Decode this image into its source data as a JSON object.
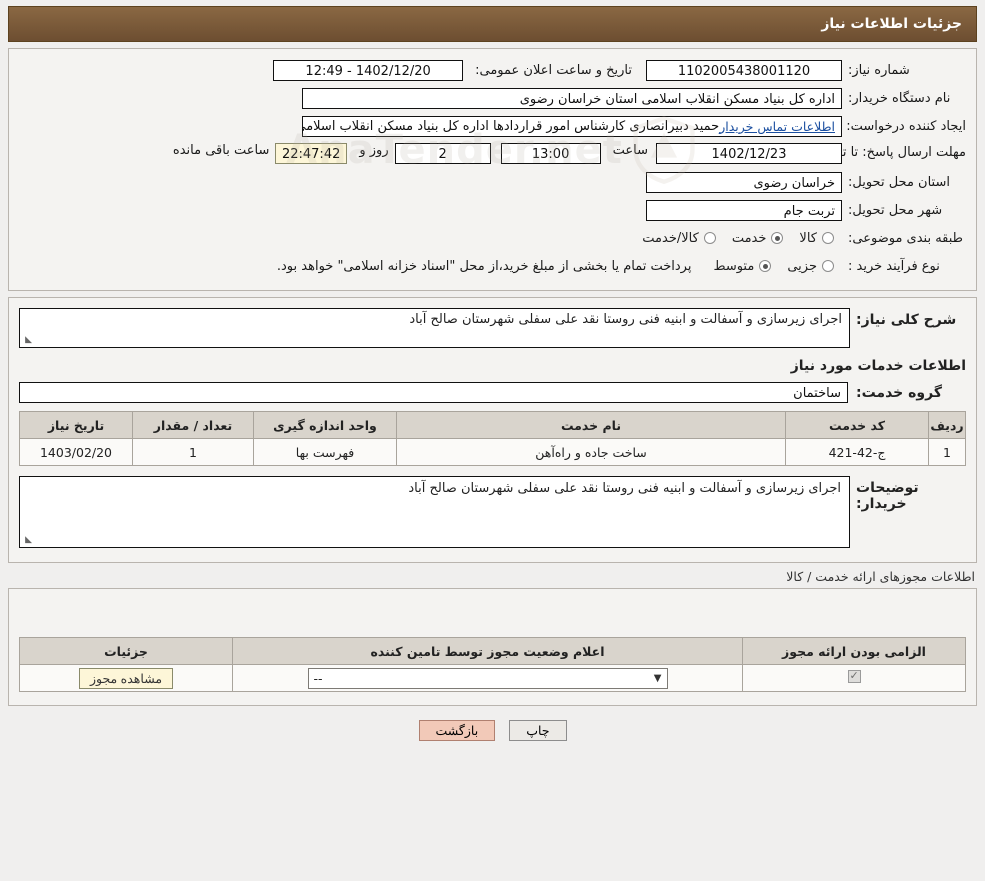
{
  "header": {
    "title": "جزئیات اطلاعات نیاز"
  },
  "need": {
    "number_label": "شماره نیاز:",
    "number_value": "1102005438001120",
    "announce_label": "تاریخ و ساعت اعلان عمومی:",
    "announce_value": "1402/12/20 - 12:49",
    "buyer_org_label": "نام دستگاه خریدار:",
    "buyer_org_value": "اداره کل بنیاد مسکن انقلاب اسلامی استان خراسان رضوی",
    "creator_label": "ایجاد کننده درخواست:",
    "creator_value": "حمید دبیرانصاری کارشناس امور قراردادها اداره کل بنیاد مسکن انقلاب اسلامی ا",
    "creator_link": "اطلاعات تماس خریدار",
    "deadline_label": "مهلت ارسال پاسخ: تا تاریخ:",
    "deadline_date": "1402/12/23",
    "hour_label": "ساعت",
    "deadline_time": "13:00",
    "days_value": "2",
    "days_label": "روز و",
    "remaining_time": "22:47:42",
    "remaining_label": "ساعت باقی مانده",
    "province_label": "استان محل تحویل:",
    "province_value": "خراسان رضوی",
    "city_label": "شهر محل تحویل:",
    "city_value": "تربت جام",
    "category_label": "طبقه بندی موضوعی:",
    "category_options": [
      {
        "label": "کالا",
        "selected": false
      },
      {
        "label": "خدمت",
        "selected": true
      },
      {
        "label": "کالا/خدمت",
        "selected": false
      }
    ],
    "process_label": "نوع فرآیند خرید :",
    "process_options": [
      {
        "label": "جزیی",
        "selected": false
      },
      {
        "label": "متوسط",
        "selected": true
      }
    ],
    "process_note": "پرداخت تمام یا بخشی از مبلغ خرید،از محل \"اسناد خزانه اسلامی\" خواهد بود."
  },
  "watermark": {
    "text": "AnaTender.net"
  },
  "summary": {
    "label": "شرح کلی نیاز:",
    "value": "اجرای زیرسازی و آسفالت و ابنیه فنی روستا نقد علی سفلی شهرستان صالح آباد"
  },
  "services": {
    "title": "اطلاعات خدمات مورد نیاز",
    "group_label": "گروه خدمت:",
    "group_value": "ساختمان",
    "table": {
      "columns": [
        "ردیف",
        "کد خدمت",
        "نام خدمت",
        "واحد اندازه گیری",
        "تعداد / مقدار",
        "تاریخ نیاز"
      ],
      "rows": [
        [
          "1",
          "ج-42-421",
          "ساخت جاده و راه‌آهن",
          "فهرست بها",
          "1",
          "1403/02/20"
        ]
      ]
    }
  },
  "buyer_notes": {
    "label": "توضیحات خریدار:",
    "value": "اجرای زیرسازی و آسفالت و ابنیه فنی روستا نقد علی سفلی شهرستان صالح آباد"
  },
  "licenses": {
    "note": "اطلاعات مجوزهای ارائه خدمت / کالا",
    "columns": [
      "الزامی بودن ارائه مجوز",
      "اعلام وضعیت مجوز توسط تامین کننده",
      "جزئیات"
    ],
    "rows": [
      {
        "required_checked": true,
        "status_value": "--",
        "detail_button": "مشاهده مجوز"
      }
    ]
  },
  "footer": {
    "print_button": "چاپ",
    "back_button": "بازگشت"
  }
}
